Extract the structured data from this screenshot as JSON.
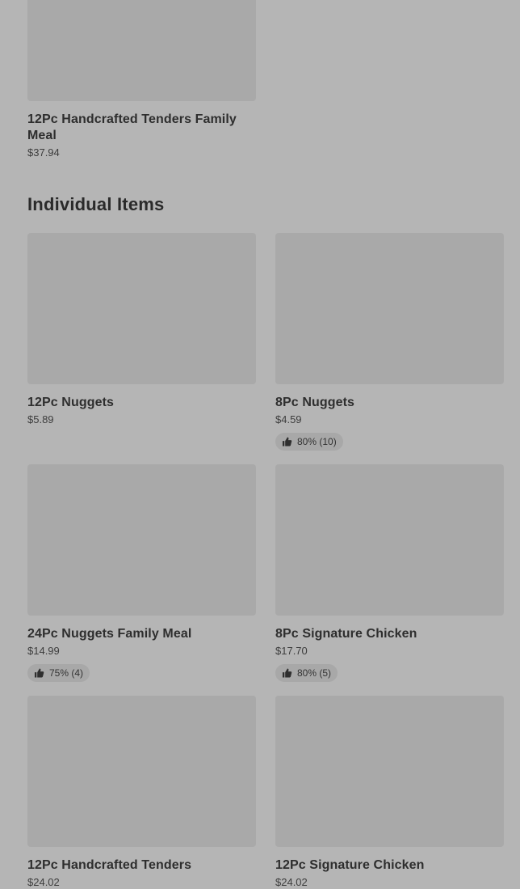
{
  "top_item": {
    "name": "12Pc Handcrafted Tenders Family Meal",
    "price": "$37.94"
  },
  "section": {
    "title": "Individual Items"
  },
  "items": [
    {
      "name": "12Pc Nuggets",
      "price": "$5.89",
      "rating": ""
    },
    {
      "name": "8Pc Nuggets",
      "price": "$4.59",
      "rating": "80% (10)"
    },
    {
      "name": "24Pc Nuggets Family Meal",
      "price": "$14.99",
      "rating": "75% (4)"
    },
    {
      "name": "8Pc Signature Chicken",
      "price": "$17.70",
      "rating": "80% (5)"
    },
    {
      "name": "12Pc Handcrafted Tenders",
      "price": "$24.02",
      "rating": ""
    },
    {
      "name": "12Pc Signature Chicken",
      "price": "$24.02",
      "rating": ""
    }
  ],
  "icons": {
    "rating": "thumbs-up-icon"
  }
}
